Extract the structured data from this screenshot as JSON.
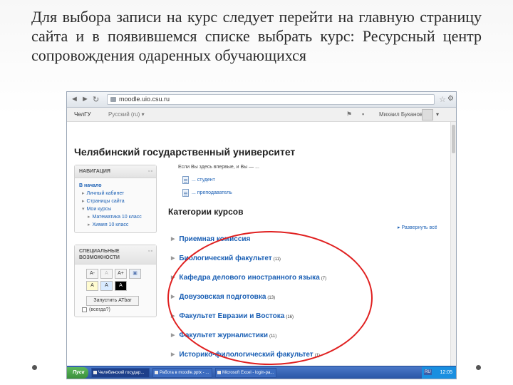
{
  "caption": "Для выбора записи на курс следует перейти на главную страницу сайта и в появившемся списке выбрать курс: Ресурсный центр сопровождения одаренных обучающихся",
  "browser": {
    "url": "moodle.uio.csu.ru",
    "back_glyph": "◄",
    "forward_glyph": "►",
    "reload_glyph": "↻",
    "star_glyph": "☆",
    "wrench_glyph": "⚙"
  },
  "moodle_topbar": {
    "brand": "ЧелГУ",
    "language": "Русский (ru) ▾",
    "user_name": "Михаил Буканов",
    "user_caret": "▾",
    "flag_glyph": "⚑",
    "chat_glyph": "▪"
  },
  "site_title": "Челябинский государственный университет",
  "navigation_block": {
    "title": "НАВИГАЦИЯ",
    "controls": "▫▫",
    "home": "В начало",
    "items": [
      {
        "label": "Личный кабинет",
        "level": 1
      },
      {
        "label": "Страницы сайта",
        "level": 1
      },
      {
        "label": "Мои курсы",
        "level": 1
      },
      {
        "label": "Математика 10 класс",
        "level": 2
      },
      {
        "label": "Химия 10 класс",
        "level": 2
      }
    ]
  },
  "accessibility_block": {
    "title_line1": "СПЕЦИАЛЬНЫЕ",
    "title_line2": "ВОЗМОЖНОСТИ",
    "controls": "▫▫",
    "row1": [
      "A-",
      "A",
      "A+"
    ],
    "row2": [
      "A",
      "A",
      "A"
    ],
    "atbar_button": "Запустить ATbar",
    "atbar_option": "(всегда?)"
  },
  "welcome_text": "Если Вы здесь впервые, и Вы — ...",
  "roles": [
    "... студент",
    "... преподаватель"
  ],
  "categories_title": "Категории курсов",
  "expand_all": "▸ Развернуть всё",
  "categories": [
    {
      "name": "Приемная комиссия",
      "count": ""
    },
    {
      "name": "Биологический факультет",
      "count": "(11)"
    },
    {
      "name": "Кафедра делового иностранного языка",
      "count": "(7)"
    },
    {
      "name": "Довузовская подготовка",
      "count": "(13)"
    },
    {
      "name": "Факультет Евразии и Востока",
      "count": "(16)"
    },
    {
      "name": "Факультет журналистики",
      "count": "(11)"
    },
    {
      "name": "Историко-филологический факультет",
      "count": "(1)"
    }
  ],
  "taskbar": {
    "start": "Пуск",
    "tasks": [
      "Челябинский государ...",
      "Работа в moodle.pptx - ...",
      "Microsoft Excel - login-pa..."
    ],
    "tray_lang": "RU",
    "time": "12:05"
  },
  "colors": {
    "link": "#1a5fb4",
    "highlight": "#e02020",
    "taskbar": "#2a56a6"
  }
}
